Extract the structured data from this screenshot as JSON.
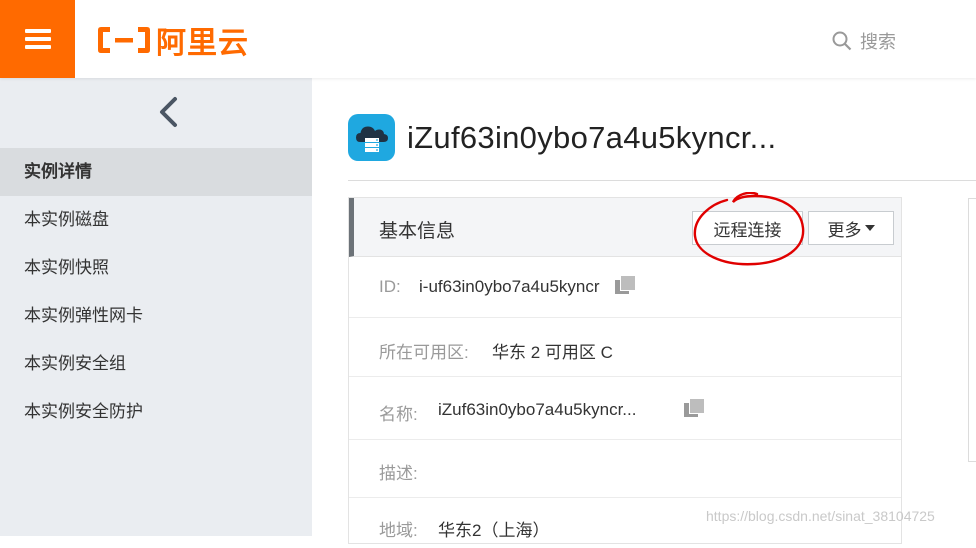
{
  "header": {
    "brand": "阿里云",
    "search_label": "搜索"
  },
  "sidebar": {
    "items": [
      {
        "label": "实例详情"
      },
      {
        "label": "本实例磁盘"
      },
      {
        "label": "本实例快照"
      },
      {
        "label": "本实例弹性网卡"
      },
      {
        "label": "本实例安全组"
      },
      {
        "label": "本实例安全防护"
      }
    ]
  },
  "main": {
    "title": "iZuf63in0ybo7a4u5kyncr...",
    "card": {
      "title": "基本信息",
      "remote_btn": "远程连接",
      "more_btn": "更多",
      "rows": [
        {
          "label": "ID:",
          "value": "i-uf63in0ybo7a4u5kyncr"
        },
        {
          "label": "所在可用区:",
          "value": "华东 2 可用区 C"
        },
        {
          "label": "名称:",
          "value": "iZuf63in0ybo7a4u5kyncr..."
        },
        {
          "label": "描述:",
          "value": ""
        },
        {
          "label": "地域:",
          "value": "华东2（上海）"
        }
      ]
    }
  },
  "watermark": "https://blog.csdn.net/sinat_38104725",
  "colors": {
    "accent": "#ff6a00",
    "sidebar_bg": "#eaedf1",
    "annotation": "#e00000"
  }
}
